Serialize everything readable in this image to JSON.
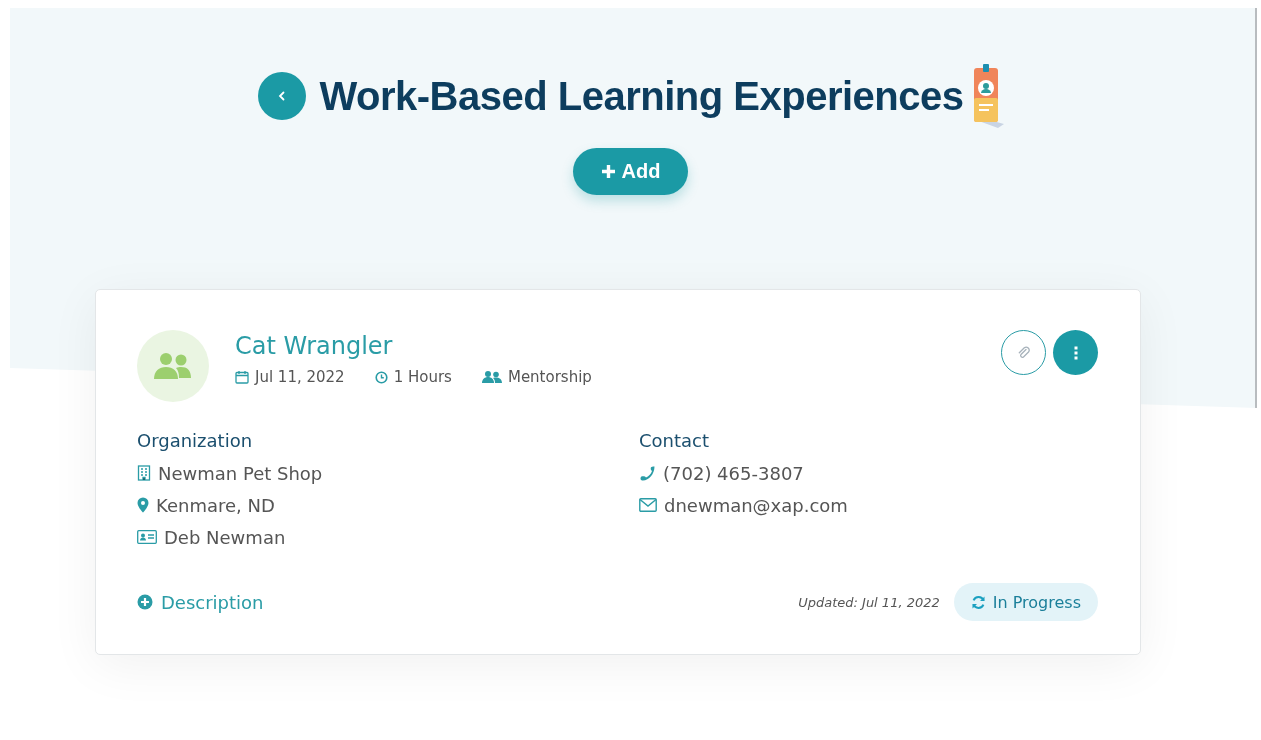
{
  "header": {
    "title": "Work-Based Learning Experiences",
    "add_button": "Add"
  },
  "experience": {
    "title": "Cat Wrangler",
    "meta": [
      {
        "kind": "calendar",
        "text": "Jul 11, 2022"
      },
      {
        "kind": "clock",
        "text": "1 Hours"
      },
      {
        "kind": "users",
        "text": "Mentorship"
      }
    ],
    "organization": {
      "heading": "Organization",
      "items": [
        {
          "kind": "building",
          "text": "Newman Pet Shop"
        },
        {
          "kind": "pin",
          "text": "Kenmare, ND"
        },
        {
          "kind": "idcard",
          "text": "Deb Newman"
        }
      ]
    },
    "contact": {
      "heading": "Contact",
      "items": [
        {
          "kind": "phone",
          "text": "(702) 465-3807"
        },
        {
          "kind": "mail",
          "text": "dnewman@xap.com"
        }
      ]
    },
    "description_link": "Description",
    "updated": "Updated: Jul 11, 2022",
    "status": {
      "kind": "in_progress",
      "label": "In Progress"
    }
  }
}
